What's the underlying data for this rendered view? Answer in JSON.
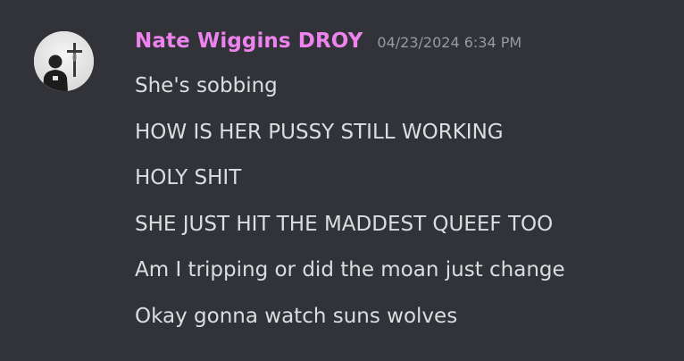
{
  "message": {
    "author": "Nate Wiggins DROY",
    "author_color": "#ee82ee",
    "timestamp": "04/23/2024 6:34 PM",
    "avatar_icon": "user-avatar-photo",
    "lines": [
      "She's sobbing",
      "HOW IS HER PUSSY STILL WORKING",
      "HOLY SHIT",
      "SHE JUST HIT THE MADDEST QUEEF TOO",
      "Am I tripping or did the moan just change",
      "Okay gonna watch suns wolves"
    ]
  },
  "colors": {
    "background": "#313338",
    "text": "#dbdee1",
    "timestamp": "#949ba4"
  }
}
